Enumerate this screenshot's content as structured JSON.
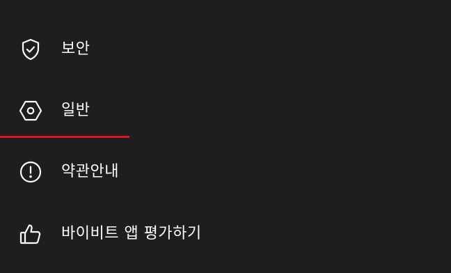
{
  "colors": {
    "background": "#1e1e20",
    "text": "#ffffff",
    "accent": "#e0161d"
  },
  "menu": {
    "items": [
      {
        "id": "security",
        "label": "보안",
        "icon": "shield-check-icon"
      },
      {
        "id": "general",
        "label": "일반",
        "icon": "hex-nut-settings-icon"
      },
      {
        "id": "terms",
        "label": "약관안내",
        "icon": "exclamation-circle-icon"
      },
      {
        "id": "rate",
        "label": "바이비트 앱 평가하기",
        "icon": "thumbs-up-icon"
      }
    ],
    "active_item": "general"
  }
}
